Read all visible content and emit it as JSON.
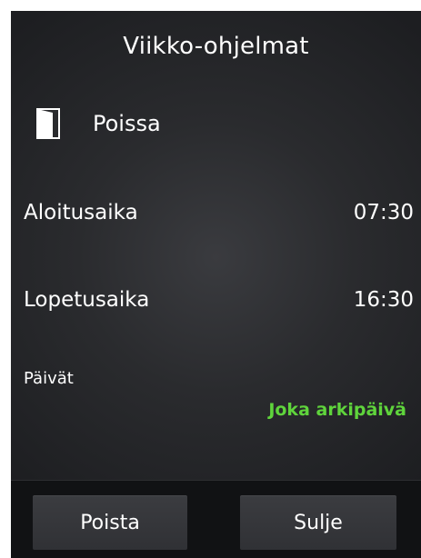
{
  "title": "Viikko-ohjelmat",
  "mode": {
    "icon": "door-icon",
    "label": "Poissa"
  },
  "start": {
    "label": "Aloitusaika",
    "value": "07:30"
  },
  "end": {
    "label": "Lopetusaika",
    "value": "16:30"
  },
  "days": {
    "label": "Päivät",
    "value": "Joka arkipäivä",
    "value_color": "#5fd43c"
  },
  "buttons": {
    "delete_label": "Poista",
    "close_label": "Sulje"
  },
  "colors": {
    "background": "#2a2b2e",
    "bottom_bar": "#111214",
    "button": "#36373b",
    "text": "#ffffff"
  }
}
